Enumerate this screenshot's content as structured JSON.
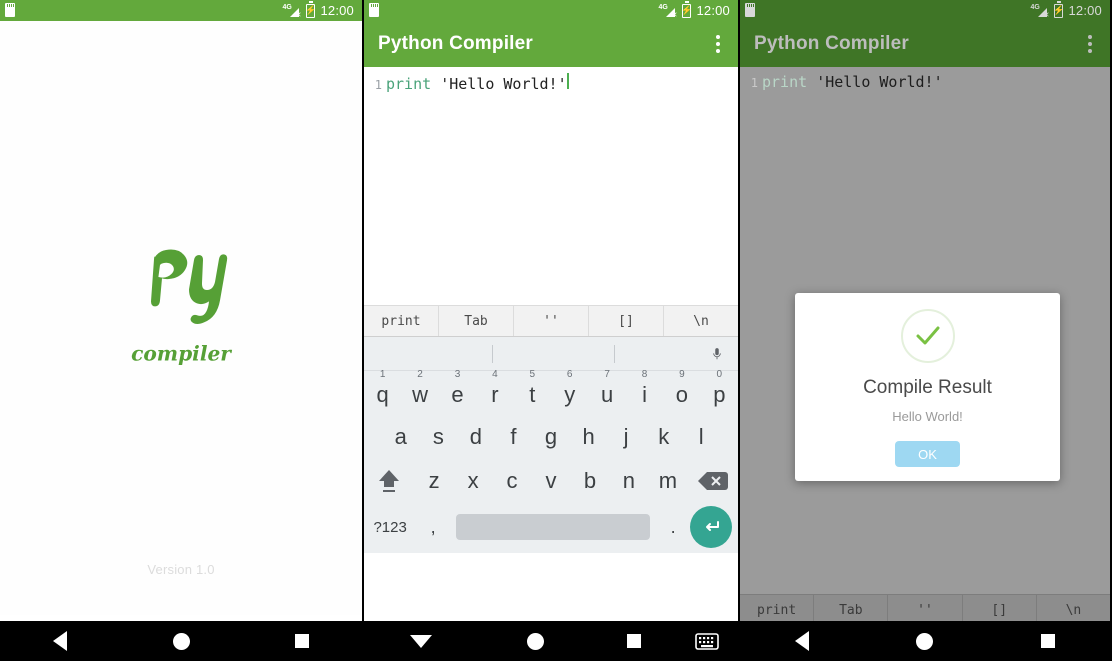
{
  "colors": {
    "brand_green": "#63a93c",
    "brand_green_dim": "#3f7526",
    "logo_green": "#56a036",
    "keyword_green": "#4aa37a",
    "enter_teal": "#34a592",
    "ok_blue": "#9ed8f2",
    "check_green": "#7ac143",
    "dim_scrim": "#9b9b9b"
  },
  "statusbar": {
    "clock": "12:00",
    "network": "4G",
    "sim_icon": "sim-card-icon",
    "signal_icon": "signal-4g-no-service-icon",
    "battery_icon": "battery-charging-icon"
  },
  "panel1": {
    "name": "splash-screen",
    "logo_primary": "Py",
    "logo_secondary": "compiler",
    "version": "Version 1.0",
    "navbar": {
      "back": "back-icon",
      "home": "home-icon",
      "recents": "recents-icon"
    }
  },
  "panel2": {
    "name": "editor-screen",
    "appbar": {
      "title": "Python Compiler",
      "menu": "overflow-menu-icon"
    },
    "editor": {
      "line_number": "1",
      "keyword": "print",
      "string": "'Hello World!'",
      "caret": "text-caret"
    },
    "shortcut_bar": [
      "print",
      "Tab",
      "''",
      "[]",
      "\\n"
    ],
    "keyboard": {
      "suggestion_strip_empty": true,
      "mic_icon": "microphone-icon",
      "row1": [
        {
          "key": "q",
          "num": "1"
        },
        {
          "key": "w",
          "num": "2"
        },
        {
          "key": "e",
          "num": "3"
        },
        {
          "key": "r",
          "num": "4"
        },
        {
          "key": "t",
          "num": "5"
        },
        {
          "key": "y",
          "num": "6"
        },
        {
          "key": "u",
          "num": "7"
        },
        {
          "key": "i",
          "num": "8"
        },
        {
          "key": "o",
          "num": "9"
        },
        {
          "key": "p",
          "num": "0"
        }
      ],
      "row2": [
        "a",
        "s",
        "d",
        "f",
        "g",
        "h",
        "j",
        "k",
        "l"
      ],
      "row3": {
        "shift": "shift-icon",
        "keys": [
          "z",
          "x",
          "c",
          "v",
          "b",
          "n",
          "m"
        ],
        "backspace": "backspace-icon"
      },
      "row4": {
        "symbols": "?123",
        "comma": ",",
        "space": "",
        "period": ".",
        "enter": "enter-icon"
      }
    },
    "navbar": {
      "back": "dismiss-keyboard-icon",
      "home": "home-icon",
      "recents": "recents-icon",
      "keyboard": "keyboard-icon"
    }
  },
  "panel3": {
    "name": "compile-result-screen",
    "appbar": {
      "title": "Python Compiler",
      "menu": "overflow-menu-icon"
    },
    "editor": {
      "line_number": "1",
      "keyword": "print",
      "string": "'Hello World!'"
    },
    "dialog": {
      "icon": "success-check-icon",
      "title": "Compile Result",
      "message": "Hello World!",
      "ok_label": "OK"
    },
    "shortcut_bar": [
      "print",
      "Tab",
      "''",
      "[]",
      "\\n"
    ],
    "navbar": {
      "back": "back-icon",
      "home": "home-icon",
      "recents": "recents-icon"
    }
  }
}
